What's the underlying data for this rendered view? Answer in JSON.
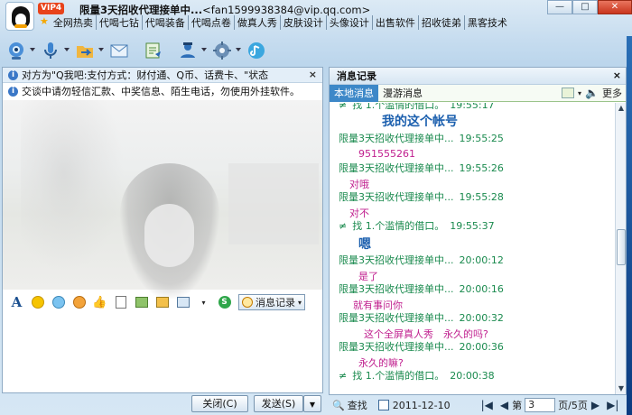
{
  "window": {
    "vip": "VIP4",
    "title_name": "限量3天招收代理接单中...",
    "title_email": "<fan1599938384@vip.qq.com>",
    "links": [
      "全网热卖",
      "代喝七钻",
      "代喝装备",
      "代喝点卷",
      "做真人秀",
      "皮肤设计",
      "头像设计",
      "出售软件",
      "招收徒弟",
      "黑客技术"
    ]
  },
  "toolbar": {
    "icons": [
      "video-call-icon",
      "voice-call-icon",
      "file-transfer-icon",
      "email-icon",
      "send-sms-icon",
      "create-group-icon",
      "app-tools-icon",
      "qq-music-icon"
    ]
  },
  "left": {
    "tip": "对方为\"Q我吧:支付方式：财付通、Q币、话费卡、\"状态",
    "warning": "交谈中请勿轻信汇款、中奖信息、陌生电话，勿使用外挂软件。",
    "message_record": "消息记录",
    "close_btn": "关闭(C)",
    "send_btn": "发送(S)"
  },
  "right": {
    "title": "消息记录",
    "tab_local": "本地消息",
    "tab_roam": "漫游消息",
    "more": "更多",
    "messages": [
      {
        "kind": "me",
        "sender": "找 1.个滥情的借口。",
        "time": "19:55:17"
      },
      {
        "kind": "big",
        "text": "我的这个帐号"
      },
      {
        "kind": "sender",
        "sender": "限量3天招收代理接单中...",
        "time": "19:55:25"
      },
      {
        "kind": "body",
        "text": "951555261"
      },
      {
        "kind": "sender",
        "sender": "限量3天招收代理接单中...",
        "time": "19:55:26"
      },
      {
        "kind": "body",
        "text": "对哦"
      },
      {
        "kind": "sender",
        "sender": "限量3天招收代理接单中...",
        "time": "19:55:28"
      },
      {
        "kind": "body",
        "text": "对不"
      },
      {
        "kind": "me",
        "sender": "找 1.个滥情的借口。",
        "time": "19:55:37"
      },
      {
        "kind": "big2",
        "text": "嗯"
      },
      {
        "kind": "sender",
        "sender": "限量3天招收代理接单中...",
        "time": "20:00:12"
      },
      {
        "kind": "body",
        "text": "是了"
      },
      {
        "kind": "sender",
        "sender": "限量3天招收代理接单中...",
        "time": "20:00:16"
      },
      {
        "kind": "body",
        "text": "就有事问你"
      },
      {
        "kind": "sender",
        "sender": "限量3天招收代理接单中...",
        "time": "20:00:32"
      },
      {
        "kind": "body",
        "text": "这个全屏真人秀　永久的吗?"
      },
      {
        "kind": "sender",
        "sender": "限量3天招收代理接单中...",
        "time": "20:00:36"
      },
      {
        "kind": "body",
        "text": "永久的嘛?"
      },
      {
        "kind": "me",
        "sender": "找 1.个滥情的借口。",
        "time": "20:00:38"
      }
    ],
    "search": "查找",
    "date": "2011-12-10",
    "page_prefix": "第",
    "page_value": "3",
    "page_suffix": "页/5页"
  },
  "colors": {
    "sender": "#1a8a4e",
    "body": "#c0208f",
    "big": "#1b5fae",
    "tab_active": "#3d88c8"
  }
}
